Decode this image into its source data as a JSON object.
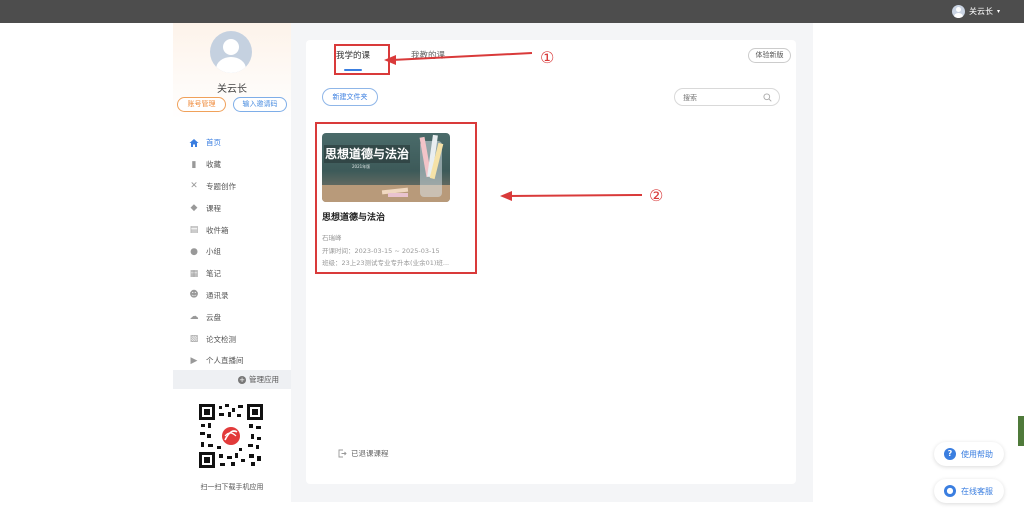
{
  "topbar": {
    "username": "关云长",
    "caret": "▾"
  },
  "profile": {
    "name": "关云长",
    "account_button": "账号管理",
    "invite_button": "输入邀请码"
  },
  "nav": {
    "items": [
      {
        "label": "首页",
        "icon": "home-icon",
        "glyph": "⌂"
      },
      {
        "label": "收藏",
        "icon": "bookmark-icon",
        "glyph": "▮"
      },
      {
        "label": "专题创作",
        "icon": "tools-icon",
        "glyph": "✕"
      },
      {
        "label": "课程",
        "icon": "graduation-cap-icon",
        "glyph": "◆"
      },
      {
        "label": "收件箱",
        "icon": "inbox-icon",
        "glyph": "▤"
      },
      {
        "label": "小组",
        "icon": "group-icon",
        "glyph": "●"
      },
      {
        "label": "笔记",
        "icon": "note-icon",
        "glyph": "▦"
      },
      {
        "label": "通讯录",
        "icon": "contacts-icon",
        "glyph": "☻"
      },
      {
        "label": "云盘",
        "icon": "cloud-icon",
        "glyph": "☁"
      },
      {
        "label": "论文检测",
        "icon": "document-check-icon",
        "glyph": "▧"
      },
      {
        "label": "个人直播间",
        "icon": "play-icon",
        "glyph": "▶"
      }
    ],
    "manage_label": "管理应用",
    "qr_caption": "扫一扫下载手机应用"
  },
  "tabs": {
    "my_courses": "我学的课",
    "teaching": "我教的课",
    "new_version": "体验新版"
  },
  "toolbar": {
    "new_folder": "新建文件夹",
    "search_placeholder": "搜索"
  },
  "course": {
    "cover_title": "思想道德与法治",
    "cover_subtitle": "2021年版",
    "title": "思想道德与法治",
    "teacher": "石瑞峰",
    "period": "开课时间：2023-03-15 ~ 2025-03-15",
    "class": "班级：23上23测试专业专升本(业余01)班..."
  },
  "footer": {
    "quit_courses": "已退课课程"
  },
  "annotations": {
    "one": "①",
    "two": "②"
  },
  "floating": {
    "help": "使用帮助",
    "service": "在线客服"
  },
  "colors": {
    "accent": "#3a7ee0",
    "annotation": "#d93a3a",
    "topbar": "#4d4d4d"
  }
}
